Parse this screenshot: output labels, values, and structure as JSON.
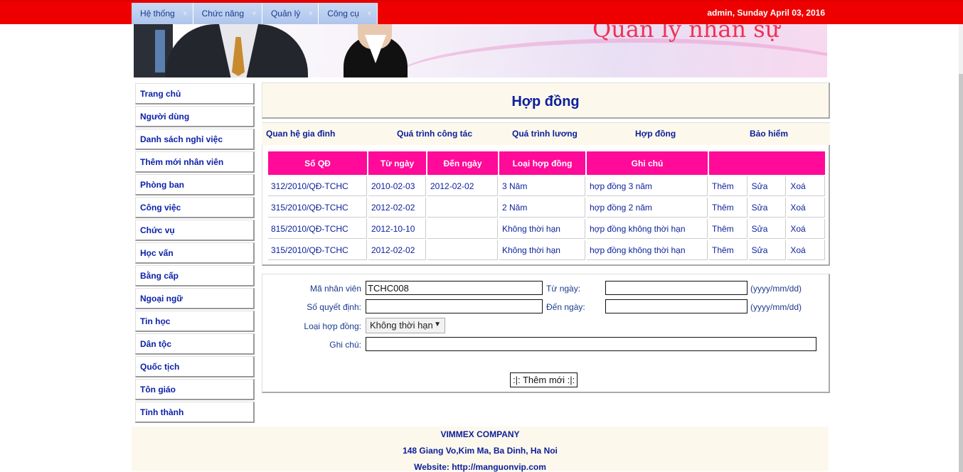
{
  "menu": [
    {
      "label": "Hệ thống"
    },
    {
      "label": "Chức năng"
    },
    {
      "label": "Quản lý"
    },
    {
      "label": "Công cụ"
    }
  ],
  "user_info": "admin, Sunday April 03, 2016",
  "banner": {
    "title": "Quản lý nhân sự"
  },
  "sidebar": {
    "items": [
      {
        "label": "Trang chủ"
      },
      {
        "label": "Người dùng"
      },
      {
        "label": "Danh sách nghỉ việc"
      },
      {
        "label": "Thêm mới nhân viên"
      },
      {
        "label": "Phòng ban"
      },
      {
        "label": "Công việc"
      },
      {
        "label": "Chức vụ"
      },
      {
        "label": "Học vấn"
      },
      {
        "label": "Bằng cấp"
      },
      {
        "label": "Ngoại ngữ"
      },
      {
        "label": "Tin học"
      },
      {
        "label": "Dân tộc"
      },
      {
        "label": "Quốc tịch"
      },
      {
        "label": "Tôn giáo"
      },
      {
        "label": "Tỉnh thành"
      }
    ]
  },
  "page_title": "Hợp đồng",
  "tabs": [
    {
      "label": "Quan hệ gia đình"
    },
    {
      "label": "Quá trình công tác"
    },
    {
      "label": "Quá trình lương"
    },
    {
      "label": "Hợp đồng"
    },
    {
      "label": "Bảo hiểm"
    }
  ],
  "table": {
    "headers": [
      "Số QĐ",
      "Từ ngày",
      "Đến ngày",
      "Loại hợp đồng",
      "Ghi chú",
      ""
    ],
    "rows": [
      {
        "so_qd": "312/2010/QĐ-TCHC",
        "tu_ngay": "2010-02-03",
        "den_ngay": "2012-02-02",
        "loai": "3 Năm",
        "ghi_chu": "hợp đồng 3 năm",
        "them": "Thêm",
        "sua": "Sửa",
        "xoa": "Xoá"
      },
      {
        "so_qd": "315/2010/QĐ-TCHC",
        "tu_ngay": "2012-02-02",
        "den_ngay": "",
        "loai": "2 Năm",
        "ghi_chu": "hợp đồng 2 năm",
        "them": "Thêm",
        "sua": "Sửa",
        "xoa": "Xoá"
      },
      {
        "so_qd": "815/2010/QĐ-TCHC",
        "tu_ngay": "2012-10-10",
        "den_ngay": "",
        "loai": "Không thời hạn",
        "ghi_chu": "hợp đồng không thời hạn",
        "them": "Thêm",
        "sua": "Sửa",
        "xoa": "Xoá"
      },
      {
        "so_qd": "315/2010/QĐ-TCHC",
        "tu_ngay": "2012-02-02",
        "den_ngay": "",
        "loai": "Không thời hạn",
        "ghi_chu": "hợp đồng không thời hạn",
        "them": "Thêm",
        "sua": "Sửa",
        "xoa": "Xoá"
      }
    ]
  },
  "form": {
    "ma_nv_label": "Mã nhân viên",
    "ma_nv_value": "TCHC008",
    "so_qd_label": "Số quyết định:",
    "so_qd_value": "",
    "tu_ngay_label": "Từ ngày:",
    "tu_ngay_value": "",
    "den_ngay_label": "Đến ngày:",
    "den_ngay_value": "",
    "date_hint": "(yyyy/mm/dd)",
    "loai_label": "Loại hợp đồng:",
    "loai_selected": "Không thời hạn",
    "ghi_chu_label": "Ghi chú:",
    "ghi_chu_value": "",
    "submit_label": ":|: Thêm mới :|:"
  },
  "footer": {
    "company": "VIMMEX COMPANY",
    "address": "148 Giang Vo,Kim Ma, Ba Dinh, Ha Noi",
    "website": "Website: http://manguonvip.com"
  },
  "colors": {
    "topbar": "#ee0000",
    "header_cell": "#ff0a99",
    "link": "#0b1e9a",
    "panel_bg": "#fdf8ec"
  }
}
